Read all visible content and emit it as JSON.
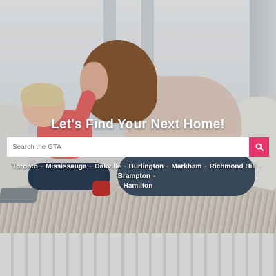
{
  "hero": {
    "headline": "Let's Find Your Next Home!"
  },
  "search": {
    "placeholder": "Search the GTA",
    "value": "",
    "button_icon": "search-icon"
  },
  "cities": {
    "separator": "-",
    "items": [
      "Toronto",
      "Mississauga",
      "Oakville",
      "Burlington",
      "Markham",
      "Richmond Hill",
      "Brampton",
      "Hamilton"
    ]
  },
  "colors": {
    "accent": "#e8356d",
    "text": "#ffffff"
  }
}
